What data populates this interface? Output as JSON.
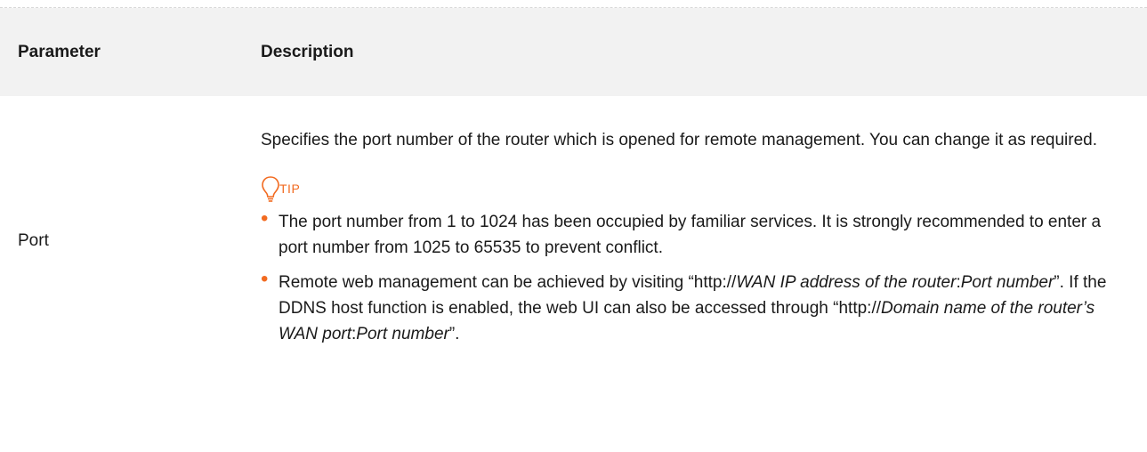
{
  "table": {
    "header": {
      "parameter": "Parameter",
      "description": "Description"
    },
    "row": {
      "parameter": "Port",
      "description": "Specifies the port number of the router which is opened for remote management. You can change it as required.",
      "tip_label": "TIP",
      "tips": {
        "tip1": "The port number from 1 to 1024 has been occupied by familiar services. It is strongly recommended to enter a port number from 1025 to 65535 to prevent conflict.",
        "tip2": {
          "t1": "Remote web management can be achieved by visiting “http://",
          "i1": "WAN IP address of the router",
          "t2": ":",
          "i2": "Port number",
          "t3": "”. If the DDNS host function is enabled, the web UI can also be accessed through “http://",
          "i3": "Domain name of the router’s WAN port",
          "t4": ":",
          "i4": "Port number",
          "t5": "”."
        }
      }
    }
  },
  "colors": {
    "accent": "#f26b21",
    "header_bg": "#f2f2f2"
  },
  "icons": {
    "tip": "lightbulb-icon",
    "bullet": "dot"
  }
}
